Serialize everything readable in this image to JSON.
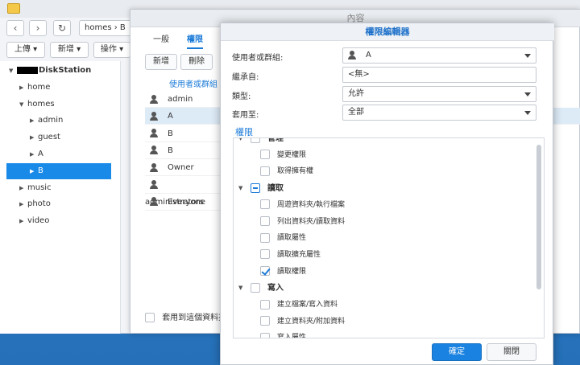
{
  "filestation": {
    "path": "homes › B",
    "toolbar": {
      "upload": "上傳 ▾",
      "create": "新增 ▾",
      "action": "操作 ▾"
    },
    "tree": [
      {
        "label": "DiskStation",
        "level": 0,
        "expanded": true
      },
      {
        "label": "home",
        "level": 1,
        "expanded": false
      },
      {
        "label": "homes",
        "level": 1,
        "expanded": true
      },
      {
        "label": "admin",
        "level": 2,
        "expanded": false
      },
      {
        "label": "guest",
        "level": 2,
        "expanded": false
      },
      {
        "label": "A",
        "level": 2,
        "expanded": false
      },
      {
        "label": "B",
        "level": 2,
        "expanded": false,
        "selected": true
      },
      {
        "label": "music",
        "level": 1,
        "expanded": false
      },
      {
        "label": "photo",
        "level": 1,
        "expanded": false
      },
      {
        "label": "video",
        "level": 1,
        "expanded": false
      }
    ]
  },
  "properties": {
    "title": "內容",
    "tabs": {
      "general": "一般",
      "permission": "權限"
    },
    "buttons": {
      "add": "新增",
      "delete": "刪除"
    },
    "column_user": "使用者或群組",
    "users": [
      "admin",
      "A",
      "B",
      "B",
      "Owner",
      "administrators",
      "Everyone"
    ],
    "apply_subfolders": "套用到這個資料夾"
  },
  "editor": {
    "title": "權限編輯器",
    "fields": {
      "user_label": "使用者或群組:",
      "user_value": "A",
      "inherit_label": "繼承自:",
      "inherit_value": "<無>",
      "type_label": "類型:",
      "type_value": "允許",
      "apply_label": "套用至:",
      "apply_value": "全部"
    },
    "perm_title": "權限",
    "permissions": [
      {
        "label": "管理",
        "group": true,
        "checked": false
      },
      {
        "label": "變更權限",
        "group": false,
        "checked": false
      },
      {
        "label": "取得擁有權",
        "group": false,
        "checked": false
      },
      {
        "label": "讀取",
        "group": true,
        "checked": "partial"
      },
      {
        "label": "周遊資料夾/執行檔案",
        "group": false,
        "checked": false
      },
      {
        "label": "列出資料夾/讀取資料",
        "group": false,
        "checked": false
      },
      {
        "label": "讀取屬性",
        "group": false,
        "checked": false
      },
      {
        "label": "讀取擴充屬性",
        "group": false,
        "checked": false
      },
      {
        "label": "讀取權限",
        "group": false,
        "checked": true
      },
      {
        "label": "寫入",
        "group": true,
        "checked": false
      },
      {
        "label": "建立檔案/寫入資料",
        "group": false,
        "checked": false
      },
      {
        "label": "建立資料夾/附加資料",
        "group": false,
        "checked": false
      },
      {
        "label": "寫入屬性",
        "group": false,
        "checked": false
      }
    ],
    "ok": "確定",
    "close": "關閉"
  }
}
